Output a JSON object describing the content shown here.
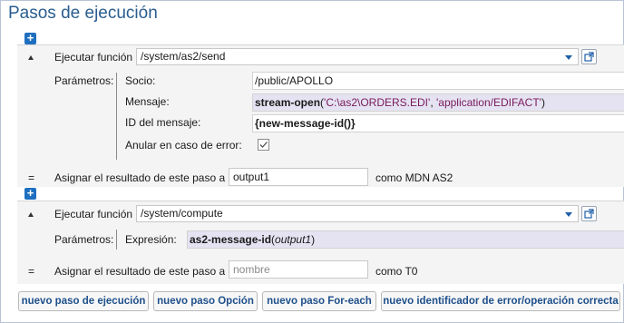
{
  "page": {
    "title": "Pasos de ejecución"
  },
  "step1": {
    "label": "Ejecutar función",
    "function": "/system/as2/send",
    "params_label": "Parámetros:",
    "params": [
      {
        "name": "Socio:",
        "value": "/public/APOLLO"
      },
      {
        "name": "Mensaje:",
        "fn": "stream-open",
        "open": "(",
        "arg1": "'C:\\as2\\ORDERS.EDI'",
        "sep": ", ",
        "arg2": "'application/EDIFACT'",
        "close": ")"
      },
      {
        "name": "ID del mensaje:",
        "value": "{new-message-id()}"
      },
      {
        "name": "Anular en caso de error:",
        "checked": true
      }
    ],
    "assign_eq": "=",
    "assign_label": "Asignar el resultado de este paso a",
    "assign_value": "output1",
    "assign_suffix": "como MDN AS2"
  },
  "step2": {
    "label": "Ejecutar función",
    "function": "/system/compute",
    "params_label": "Parámetros:",
    "expr_label": "Expresión:",
    "expr_fn": "as2-message-id",
    "expr_open": "(",
    "expr_arg": "output1",
    "expr_close": ")",
    "assign_eq": "=",
    "assign_label": "Asignar el resultado de este paso a",
    "assign_placeholder": "nombre",
    "assign_suffix": "como T0"
  },
  "buttons": {
    "new_step": "nuevo paso de ejecución",
    "new_option": "nuevo paso Opción",
    "new_foreach": "nuevo paso For-each",
    "new_error": "nuevo identificador de error/operación correcta"
  },
  "colors": {
    "title": "#2a5d8f",
    "accent": "#1f6fc0",
    "xpath_bg": "#e5e3f2"
  },
  "icons": [
    "plus-icon",
    "collapse-icon",
    "dropdown-icon",
    "open-link-icon",
    "checkmark-icon"
  ]
}
